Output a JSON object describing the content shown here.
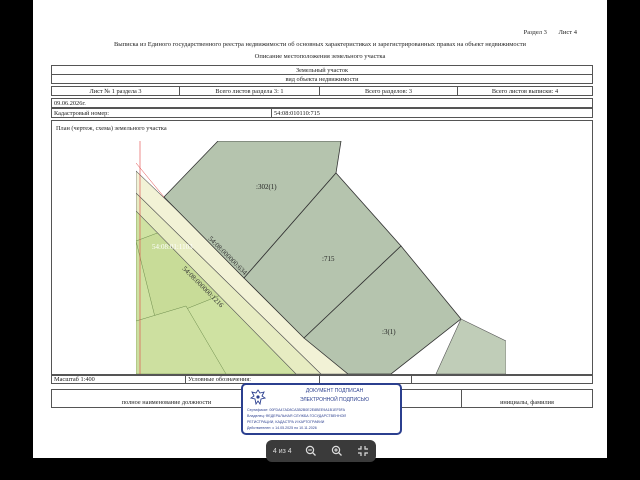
{
  "header": {
    "section": "Раздел 3",
    "sheet": "Лист 4",
    "title": "Выписка из Единого государственного реестра недвижимости об основных характеристиках и зарегистрированных правах на объект недвижимости",
    "subtitle": "Описание местоположения земельного участка"
  },
  "object": {
    "type": "Земельный участок",
    "kind_label": "вид объекта недвижимости"
  },
  "sheet_info": {
    "sheet_no": "Лист № 1 раздела 3",
    "total_sheets_section": "Всего листов раздела 3: 1",
    "total_sections": "Всего разделов: 3",
    "total_sheets_extract": "Всего листов выписки: 4"
  },
  "meta": {
    "date": "09.06.2026г.",
    "cadastral_label": "Кадастровый номер:",
    "cadastral_number": "54:08:010110:715"
  },
  "plan": {
    "title": "План (чертеж, схема) земельного участка",
    "labels": {
      "parcel_302": ":302(1)",
      "parcel_715": ":715",
      "parcel_3": ":3(1)",
      "road_634": "54:08:000000:634",
      "road_1216": "54:08:000000:1216",
      "parcel_1103": "54:08:01:1103"
    },
    "colors": {
      "parcel": "#b5c4ae",
      "road": "#eef0c8",
      "field": "#cfe2a2",
      "boundary": "#444444",
      "red_line": "#e04040"
    }
  },
  "footer": {
    "scale": "Масштаб 1:400",
    "legend_label": "Условные обозначения:",
    "position_label": "полное наименование должности",
    "name_label": "инициалы, фамилия"
  },
  "stamp": {
    "line1": "ДОКУМЕНТ ПОДПИСАН",
    "line2": "ЭЛЕКТРОННОЙ ПОДПИСЬЮ",
    "cert": "Сертификат: 00FDA47AD8CA3B2B0E2E8BEE9A1B1EF5FA",
    "owner1": "Владелец: ФЕДЕРАЛЬНАЯ СЛУЖБА ГОСУДАРСТВЕННОЙ",
    "owner2": "РЕГИСТРАЦИИ, КАДАСТРА И КАРТОГРАФИИ",
    "valid": "Действителен: с 14.05.2025 по 10.11.2026",
    "color": "#2b3f8f"
  },
  "viewer": {
    "page_indicator": "4 из 4",
    "zoom_out": "zoom-out-icon",
    "zoom_in": "zoom-in-icon",
    "exit": "exit-fullscreen-icon"
  }
}
